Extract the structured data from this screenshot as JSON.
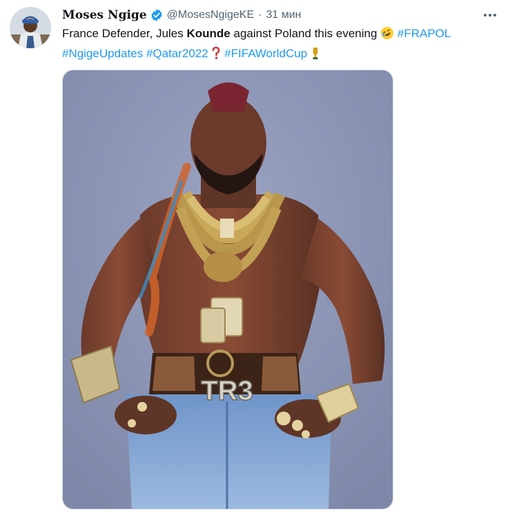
{
  "tweet": {
    "display_name": "Moses Ngige",
    "handle": "@MosesNgigeKE",
    "separator": "·",
    "time": "31 мин",
    "text_part1": "France Defender, Jules ",
    "text_bold": "Kounde",
    "text_part2": " against Poland this evening ",
    "hashtags": [
      "#FRAPOL",
      "#NgigeUpdates",
      "#Qatar2022",
      "#FIFAWorldCup"
    ],
    "emojis": [
      "rofl-emoji",
      "question-mark-emoji",
      "trophy-emoji"
    ],
    "image_text": "TR3"
  },
  "colors": {
    "link": "#1d9bf0",
    "secondary_text": "#536471",
    "verified": "#1d9bf0",
    "backdrop": "#8e98b7"
  },
  "icons": {
    "verified": "verified-badge-icon",
    "more": "more-options-icon"
  }
}
